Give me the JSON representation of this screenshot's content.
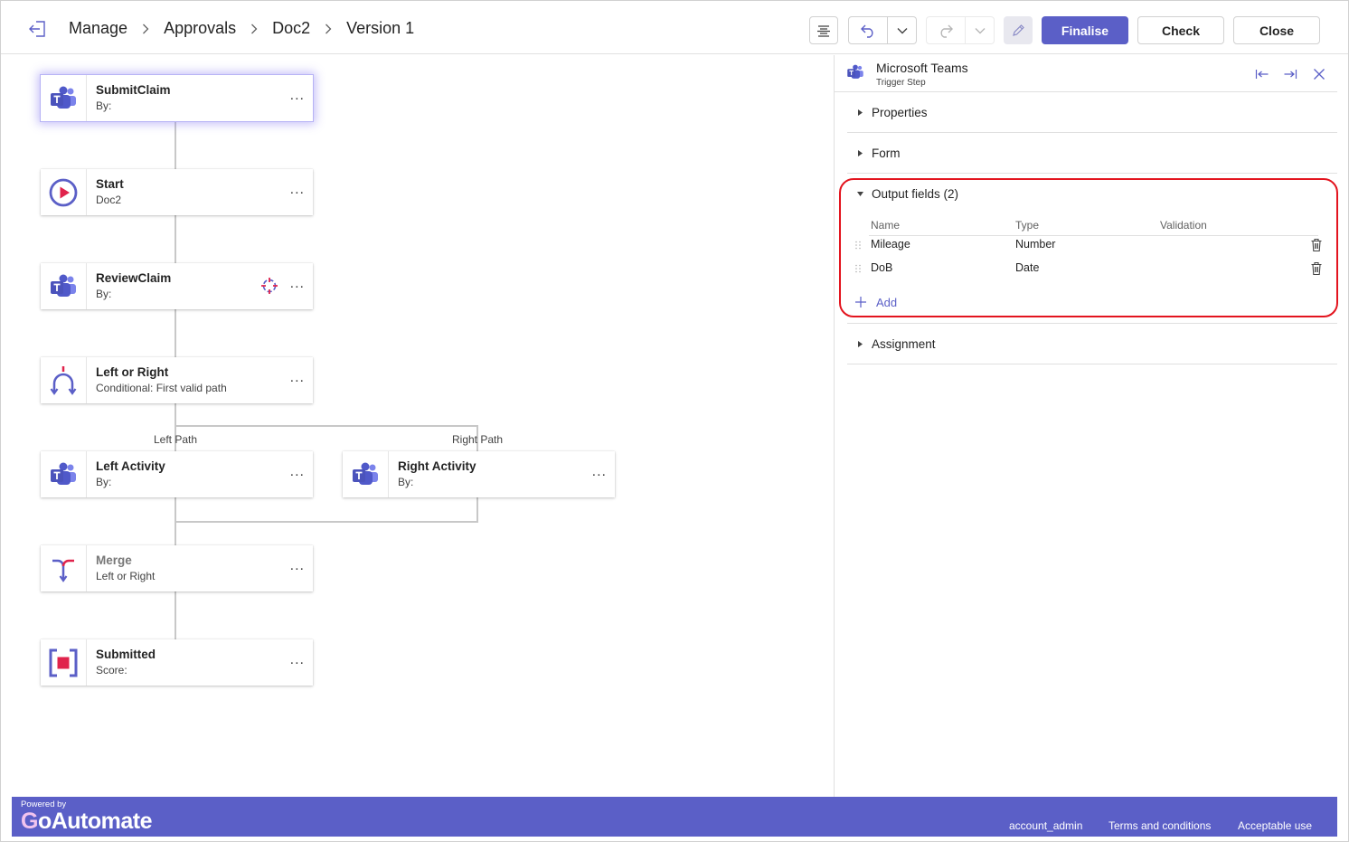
{
  "header": {
    "breadcrumbs": [
      "Manage",
      "Approvals",
      "Doc2",
      "Version 1"
    ],
    "buttons": {
      "finalise": "Finalise",
      "check": "Check",
      "close": "Close"
    }
  },
  "canvas": {
    "nodes": [
      {
        "title": "SubmitClaim",
        "subtitle": "By:",
        "icon": "teams-icon",
        "selected": true
      },
      {
        "title": "Start",
        "subtitle": "Doc2",
        "icon": "play-circle-icon"
      },
      {
        "title": "ReviewClaim",
        "subtitle": "By:",
        "icon": "teams-icon",
        "badge": "target-icon"
      },
      {
        "title": "Left or Right",
        "subtitle": "Conditional: First valid path",
        "icon": "branch-icon"
      },
      {
        "title": "Left Activity",
        "subtitle": "By:",
        "icon": "teams-icon"
      },
      {
        "title": "Right Activity",
        "subtitle": "By:",
        "icon": "teams-icon"
      },
      {
        "title": "Merge",
        "subtitle": "Left or Right",
        "icon": "merge-icon"
      },
      {
        "title": "Submitted",
        "subtitle": "Score:",
        "icon": "stop-icon"
      }
    ],
    "path_labels": {
      "left": "Left Path",
      "right": "Right Path"
    },
    "more_glyph": "..."
  },
  "panel": {
    "title": "Microsoft Teams",
    "subtitle": "Trigger Step",
    "sections": {
      "properties": "Properties",
      "form": "Form",
      "output": "Output fields (2)",
      "assignment": "Assignment"
    },
    "columns": {
      "name": "Name",
      "type": "Type",
      "validation": "Validation"
    },
    "fields": [
      {
        "name": "Mileage",
        "type": "Number"
      },
      {
        "name": "DoB",
        "type": "Date"
      }
    ],
    "add_label": "Add"
  },
  "footer": {
    "powered_by": "Powered by",
    "logo_first": "G",
    "logo_rest": "oAutomate",
    "links": {
      "account": "account_admin",
      "terms": "Terms and conditions",
      "acceptable": "Acceptable use"
    }
  },
  "colors": {
    "accent": "#5b5fc7",
    "highlight": "#e3141e",
    "connector": "#c8c8c8"
  }
}
